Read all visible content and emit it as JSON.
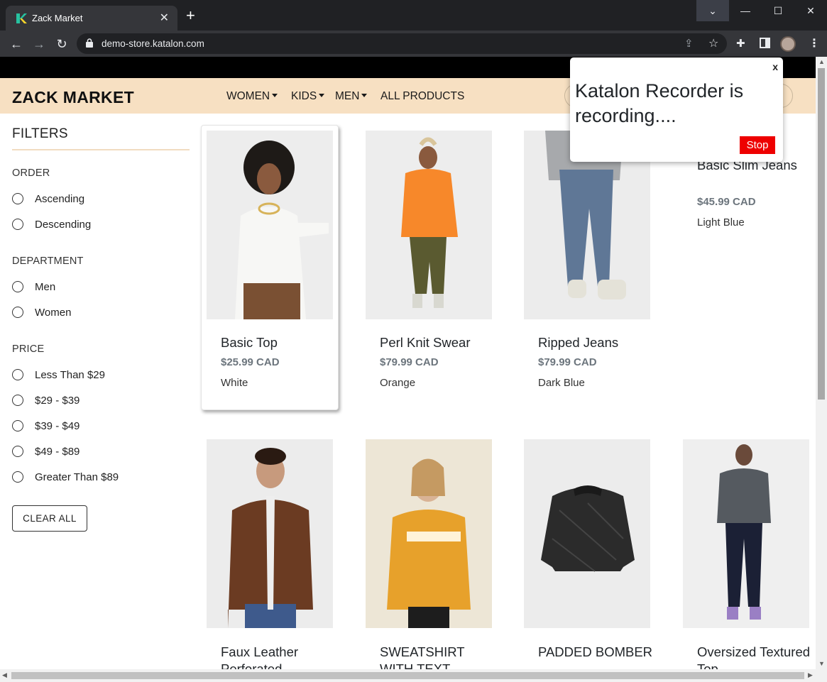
{
  "browser": {
    "tab_title": "Zack Market",
    "tab_close": "✕",
    "new_tab": "+",
    "url": "demo-store.katalon.com",
    "window_controls": {
      "dropdown": "⌄",
      "minimize": "—",
      "maximize": "☐",
      "close": "✕"
    }
  },
  "header": {
    "brand": "ZACK MARKET",
    "menu": [
      {
        "label": "WOMEN",
        "dropdown": true
      },
      {
        "label": "KIDS",
        "dropdown": true
      },
      {
        "label": "MEN",
        "dropdown": true
      },
      {
        "label": "ALL PRODUCTS",
        "dropdown": false
      }
    ]
  },
  "filters": {
    "title": "FILTERS",
    "groups": [
      {
        "title": "ORDER",
        "options": [
          "Ascending",
          "Descending"
        ]
      },
      {
        "title": "DEPARTMENT",
        "options": [
          "Men",
          "Women"
        ]
      },
      {
        "title": "PRICE",
        "options": [
          "Less Than $29",
          "$29 - $39",
          "$39 - $49",
          "$49 - $89",
          "Greater Than $89"
        ]
      }
    ],
    "clear_label": "CLEAR ALL"
  },
  "products": [
    {
      "name": "Basic Top",
      "price": "$25.99 CAD",
      "color": "White",
      "image_color": "#f3f3f3"
    },
    {
      "name": "Perl Knit Swear",
      "price": "$79.99 CAD",
      "color": "Orange",
      "image_color": "#f59a37"
    },
    {
      "name": "Ripped Jeans",
      "price": "$79.99 CAD",
      "color": "Dark Blue",
      "image_color": "#5b7394"
    },
    {
      "name": "Basic Slim Jeans",
      "price": "$45.99 CAD",
      "color": "Light Blue",
      "image_color": "#ffffff"
    },
    {
      "name": "Faux Leather Perforated",
      "price": "",
      "color": "",
      "image_color": "#6b3b22"
    },
    {
      "name": "SWEATSHIRT WITH TEXT",
      "price": "",
      "color": "",
      "image_color": "#e7a12b"
    },
    {
      "name": "PADDED BOMBER",
      "price": "",
      "color": "",
      "image_color": "#2b2b2b"
    },
    {
      "name": "Oversized Textured Top",
      "price": "",
      "color": "",
      "image_color": "#555a60"
    }
  ],
  "popup": {
    "close_label": "x",
    "message": "Katalon Recorder is recording....",
    "stop_label": "Stop"
  },
  "colors": {
    "header_bg": "#f7e0c2",
    "stop_button": "#ee0000",
    "top_strip": "#000000"
  }
}
